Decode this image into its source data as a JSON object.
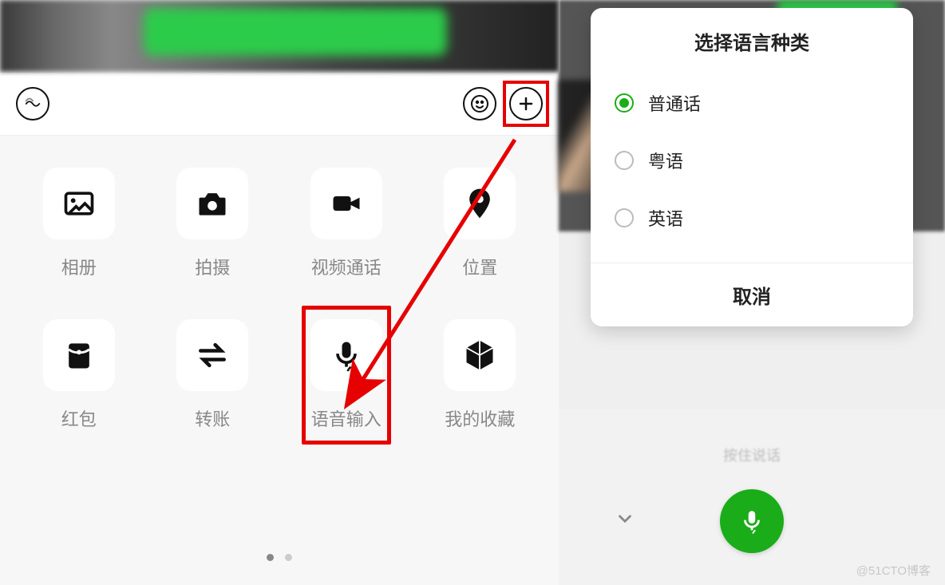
{
  "left": {
    "attachments": [
      {
        "id": "album",
        "label": "相册",
        "icon": "image-icon"
      },
      {
        "id": "shoot",
        "label": "拍摄",
        "icon": "camera-icon"
      },
      {
        "id": "videocall",
        "label": "视频通话",
        "icon": "video-icon"
      },
      {
        "id": "location",
        "label": "位置",
        "icon": "location-pin-icon"
      },
      {
        "id": "redpacket",
        "label": "红包",
        "icon": "red-envelope-icon"
      },
      {
        "id": "transfer",
        "label": "转账",
        "icon": "transfer-icon"
      },
      {
        "id": "voiceinput",
        "label": "语音输入",
        "icon": "microphone-icon"
      },
      {
        "id": "favorites",
        "label": "我的收藏",
        "icon": "cube-icon"
      }
    ],
    "highlight_plus": true,
    "highlight_voice_input": true
  },
  "right": {
    "dialog_title": "选择语言种类",
    "options": [
      {
        "label": "普通话",
        "selected": true
      },
      {
        "label": "粤语",
        "selected": false
      },
      {
        "label": "英语",
        "selected": false
      }
    ],
    "cancel_label": "取消",
    "hold_to_talk_label": "按住说话"
  },
  "watermark": "@51CTO博客"
}
